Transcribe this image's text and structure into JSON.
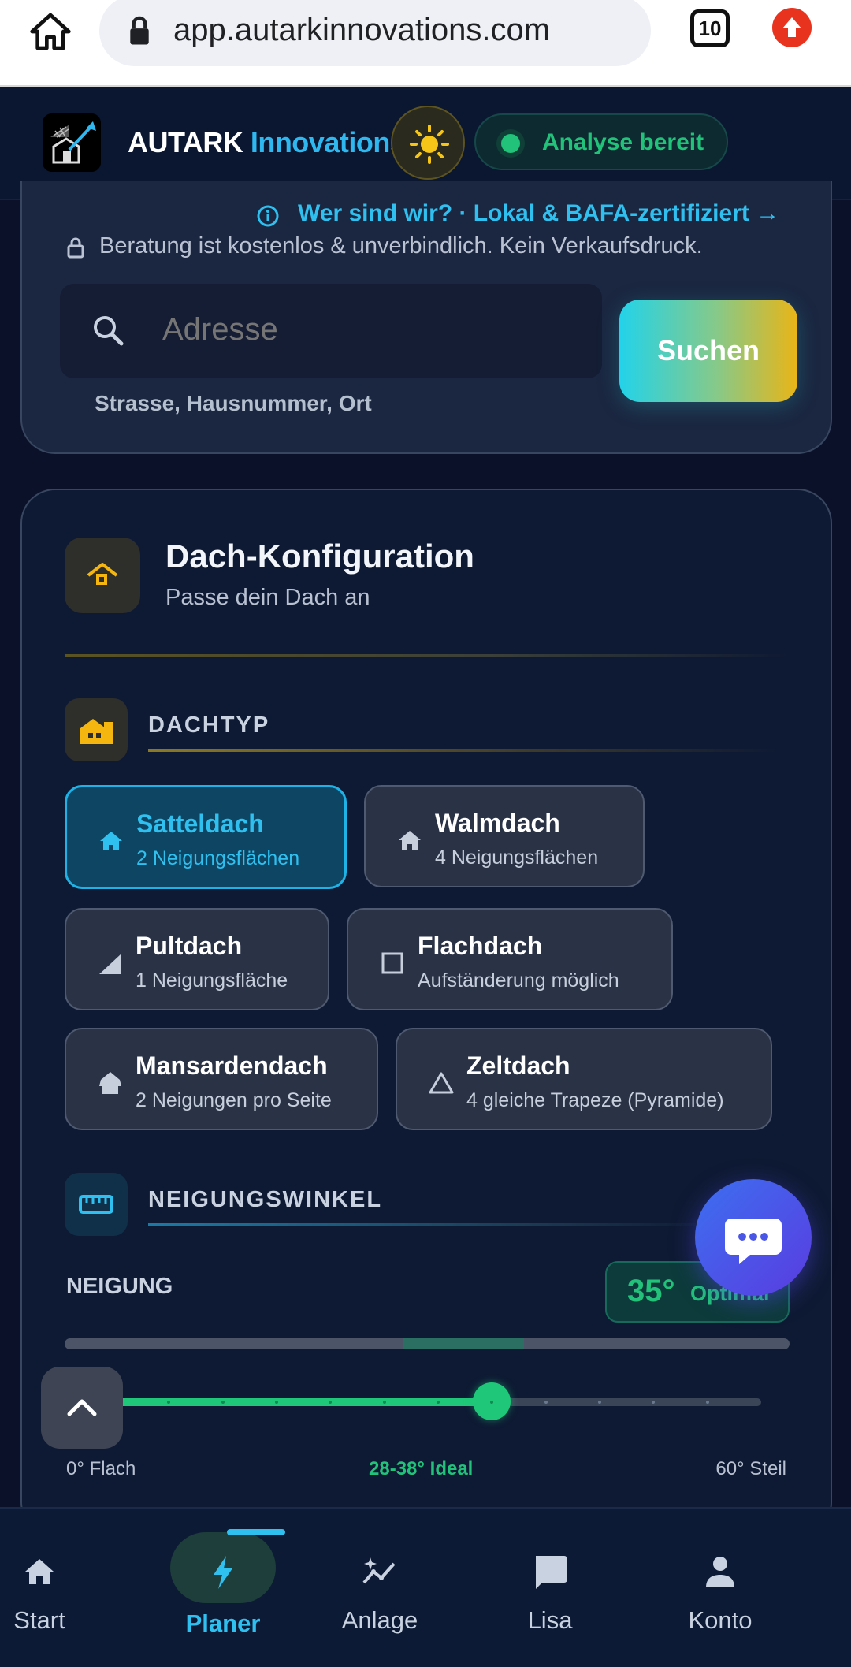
{
  "browser": {
    "url": "app.autarkinnovations.com",
    "tab_count": "10"
  },
  "header": {
    "brand_main": "AUTARK",
    "brand_accent": "Innovations",
    "status": "Analyse bereit"
  },
  "search": {
    "about_link": "Wer sind wir? · Lokal & BAFA-zertifiziert →",
    "free_note": "Beratung ist kostenlos & unverbindlich. Kein Verkaufsdruck.",
    "placeholder": "Adresse",
    "hint": "Strasse, Hausnummer, Ort",
    "button": "Suchen"
  },
  "config": {
    "title": "Dach-Konfiguration",
    "subtitle": "Passe dein Dach an",
    "roof_section": "DACHTYP",
    "roof_types": [
      {
        "name": "Satteldach",
        "desc": "2 Neigungsflächen",
        "icon": "house-icon",
        "active": true
      },
      {
        "name": "Walmdach",
        "desc": "4 Neigungsflächen",
        "icon": "house-icon",
        "active": false
      },
      {
        "name": "Pultdach",
        "desc": "1 Neigungsfläche",
        "icon": "slope-icon",
        "active": false
      },
      {
        "name": "Flachdach",
        "desc": "Aufständerung möglich",
        "icon": "square-icon",
        "active": false
      },
      {
        "name": "Mansardendach",
        "desc": "2 Neigungen pro Seite",
        "icon": "mansard-icon",
        "active": false
      },
      {
        "name": "Zeltdach",
        "desc": "4 gleiche Trapeze (Pyramide)",
        "icon": "triangle-icon",
        "active": false
      }
    ],
    "angle_section": "NEIGUNGSWINKEL",
    "neigung_label": "NEIGUNG",
    "angle_value": "35°",
    "angle_note": "Optimal",
    "angle_current": 35,
    "angle_min": 0,
    "angle_max": 60,
    "ideal_min": 28,
    "ideal_max": 38,
    "scale_min": "0° Flach",
    "scale_mid": "28-38° Ideal",
    "scale_max": "60° Steil"
  },
  "nav": {
    "items": [
      {
        "label": "Start",
        "icon": "home-icon"
      },
      {
        "label": "Planer",
        "icon": "bolt-icon"
      },
      {
        "label": "Anlage",
        "icon": "chart-sparkle-icon"
      },
      {
        "label": "Lisa",
        "icon": "chat-icon"
      },
      {
        "label": "Konto",
        "icon": "person-icon"
      }
    ],
    "active": "Planer"
  },
  "colors": {
    "accent_blue": "#2fc0f0",
    "accent_green": "#22c27a",
    "accent_gold": "#e9b517",
    "background": "#0a1128"
  }
}
